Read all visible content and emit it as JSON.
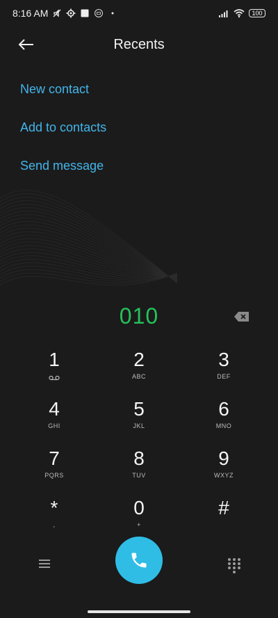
{
  "status_bar": {
    "time": "8:16 AM",
    "battery": "100",
    "left_icons": [
      "mute-icon",
      "settings-icon",
      "square-icon",
      "app-icon",
      "dot-icon"
    ],
    "right_icons": [
      "signal-icon",
      "wifi-icon",
      "battery-icon"
    ]
  },
  "header": {
    "title": "Recents",
    "back_icon": "arrow-left-icon"
  },
  "actions": [
    "New contact",
    "Add to contacts",
    "Send message"
  ],
  "dialer": {
    "number": "010",
    "backspace_icon": "backspace-icon"
  },
  "keypad": {
    "keys": [
      {
        "digit": "1",
        "letters": "",
        "sub_icon": "voicemail-icon"
      },
      {
        "digit": "2",
        "letters": "ABC"
      },
      {
        "digit": "3",
        "letters": "DEF"
      },
      {
        "digit": "4",
        "letters": "GHI"
      },
      {
        "digit": "5",
        "letters": "JKL"
      },
      {
        "digit": "6",
        "letters": "MNO"
      },
      {
        "digit": "7",
        "letters": "PQRS"
      },
      {
        "digit": "8",
        "letters": "TUV"
      },
      {
        "digit": "9",
        "letters": "WXYZ"
      },
      {
        "digit": "*",
        "letters": ","
      },
      {
        "digit": "0",
        "letters": "+"
      },
      {
        "digit": "#",
        "letters": ""
      }
    ]
  },
  "bottom_bar": {
    "menu_icon": "menu-icon",
    "call_icon": "phone-icon",
    "dialpad_icon": "dialpad-icon"
  },
  "colors": {
    "background": "#1b1b1b",
    "accent": "#43b5ea",
    "number": "#25c25b",
    "call_button": "#2fbde6"
  }
}
